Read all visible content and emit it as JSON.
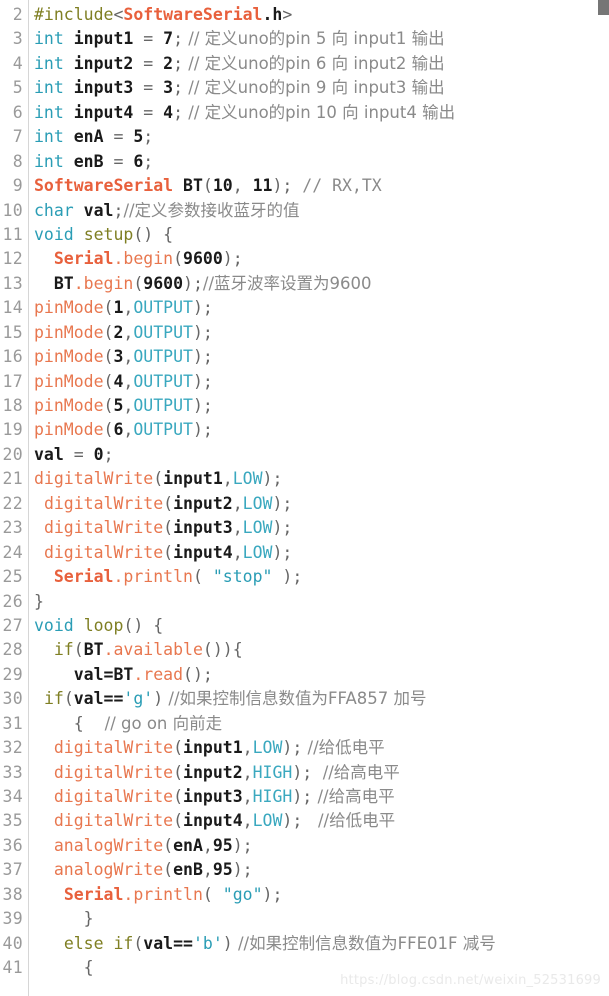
{
  "editor": {
    "language": "arduino-cpp",
    "first_line_number": 2,
    "last_line_number": 41,
    "colors": {
      "background": "#ffffff",
      "line_number": "#9a9a9a",
      "gutter_rule": "#d6d6d6",
      "type_keyword": "#2a9db5",
      "control_keyword": "#7f7f23",
      "function": "#e8774f",
      "class_name": "#e8603c",
      "constant": "#3aa8bf",
      "string": "#2a9db5",
      "comment": "#8a8a8a",
      "plain_text": "#1a1a1a",
      "scrollbar_thumb": "#767676",
      "watermark": "#e9e9e9"
    }
  },
  "watermark": {
    "text": "https://blog.csdn.net/weixin_52531699"
  },
  "lines": [
    {
      "n": "2",
      "tokens": [
        {
          "t": "keyword",
          "v": "#include"
        },
        {
          "t": "punct",
          "v": "<"
        },
        {
          "t": "class",
          "v": "SoftwareSerial"
        },
        {
          "t": "plain",
          "v": ".h"
        },
        {
          "t": "punct",
          "v": ">"
        }
      ]
    },
    {
      "n": "3",
      "tokens": [
        {
          "t": "type",
          "v": "int"
        },
        {
          "t": "plain",
          "v": " input1 "
        },
        {
          "t": "punct",
          "v": "="
        },
        {
          "t": "plain",
          "v": " 7"
        },
        {
          "t": "punct",
          "v": ";"
        },
        {
          "t": "comment",
          "v": " // 定义uno的pin 5 向 input1 输出"
        }
      ]
    },
    {
      "n": "4",
      "tokens": [
        {
          "t": "type",
          "v": "int"
        },
        {
          "t": "plain",
          "v": " input2 "
        },
        {
          "t": "punct",
          "v": "="
        },
        {
          "t": "plain",
          "v": " 2"
        },
        {
          "t": "punct",
          "v": ";"
        },
        {
          "t": "comment",
          "v": " // 定义uno的pin 6 向 input2 输出"
        }
      ]
    },
    {
      "n": "5",
      "tokens": [
        {
          "t": "type",
          "v": "int"
        },
        {
          "t": "plain",
          "v": " input3 "
        },
        {
          "t": "punct",
          "v": "="
        },
        {
          "t": "plain",
          "v": " 3"
        },
        {
          "t": "punct",
          "v": ";"
        },
        {
          "t": "comment",
          "v": " // 定义uno的pin 9 向 input3 输出"
        }
      ]
    },
    {
      "n": "6",
      "tokens": [
        {
          "t": "type",
          "v": "int"
        },
        {
          "t": "plain",
          "v": " input4 "
        },
        {
          "t": "punct",
          "v": "="
        },
        {
          "t": "plain",
          "v": " 4"
        },
        {
          "t": "punct",
          "v": ";"
        },
        {
          "t": "comment",
          "v": " // 定义uno的pin 10 向 input4 输出"
        }
      ]
    },
    {
      "n": "7",
      "tokens": [
        {
          "t": "type",
          "v": "int"
        },
        {
          "t": "plain",
          "v": " enA "
        },
        {
          "t": "punct",
          "v": "="
        },
        {
          "t": "plain",
          "v": " 5"
        },
        {
          "t": "punct",
          "v": ";"
        }
      ]
    },
    {
      "n": "8",
      "tokens": [
        {
          "t": "type",
          "v": "int"
        },
        {
          "t": "plain",
          "v": " enB "
        },
        {
          "t": "punct",
          "v": "="
        },
        {
          "t": "plain",
          "v": " 6"
        },
        {
          "t": "punct",
          "v": ";"
        }
      ]
    },
    {
      "n": "9",
      "tokens": [
        {
          "t": "class",
          "v": "SoftwareSerial"
        },
        {
          "t": "plain",
          "v": " BT"
        },
        {
          "t": "punct",
          "v": "("
        },
        {
          "t": "plain",
          "v": "10"
        },
        {
          "t": "punct",
          "v": ","
        },
        {
          "t": "plain",
          "v": " 11"
        },
        {
          "t": "punct",
          "v": ");"
        },
        {
          "t": "comment",
          "v": " // RX,TX"
        }
      ]
    },
    {
      "n": "10",
      "tokens": [
        {
          "t": "type",
          "v": "char"
        },
        {
          "t": "plain",
          "v": " val"
        },
        {
          "t": "punct",
          "v": ";"
        },
        {
          "t": "comment",
          "v": "//定义参数接收蓝牙的值"
        }
      ]
    },
    {
      "n": "11",
      "tokens": [
        {
          "t": "type",
          "v": "void"
        },
        {
          "t": "plain",
          "v": " "
        },
        {
          "t": "keyword",
          "v": "setup"
        },
        {
          "t": "punct",
          "v": "() {"
        }
      ]
    },
    {
      "n": "12",
      "tokens": [
        {
          "t": "plain",
          "v": "  "
        },
        {
          "t": "class",
          "v": "Serial"
        },
        {
          "t": "func",
          "v": ".begin"
        },
        {
          "t": "punct",
          "v": "("
        },
        {
          "t": "plain",
          "v": "9600"
        },
        {
          "t": "punct",
          "v": ");"
        }
      ]
    },
    {
      "n": "13",
      "tokens": [
        {
          "t": "plain",
          "v": "  BT"
        },
        {
          "t": "func",
          "v": ".begin"
        },
        {
          "t": "punct",
          "v": "("
        },
        {
          "t": "plain",
          "v": "9600"
        },
        {
          "t": "punct",
          "v": ");"
        },
        {
          "t": "comment",
          "v": "//蓝牙波率设置为9600"
        }
      ]
    },
    {
      "n": "14",
      "tokens": [
        {
          "t": "func",
          "v": "pinMode"
        },
        {
          "t": "punct",
          "v": "("
        },
        {
          "t": "plain",
          "v": "1"
        },
        {
          "t": "punct",
          "v": ","
        },
        {
          "t": "const",
          "v": "OUTPUT"
        },
        {
          "t": "punct",
          "v": ");"
        }
      ]
    },
    {
      "n": "15",
      "tokens": [
        {
          "t": "func",
          "v": "pinMode"
        },
        {
          "t": "punct",
          "v": "("
        },
        {
          "t": "plain",
          "v": "2"
        },
        {
          "t": "punct",
          "v": ","
        },
        {
          "t": "const",
          "v": "OUTPUT"
        },
        {
          "t": "punct",
          "v": ");"
        }
      ]
    },
    {
      "n": "16",
      "tokens": [
        {
          "t": "func",
          "v": "pinMode"
        },
        {
          "t": "punct",
          "v": "("
        },
        {
          "t": "plain",
          "v": "3"
        },
        {
          "t": "punct",
          "v": ","
        },
        {
          "t": "const",
          "v": "OUTPUT"
        },
        {
          "t": "punct",
          "v": ");"
        }
      ]
    },
    {
      "n": "17",
      "tokens": [
        {
          "t": "func",
          "v": "pinMode"
        },
        {
          "t": "punct",
          "v": "("
        },
        {
          "t": "plain",
          "v": "4"
        },
        {
          "t": "punct",
          "v": ","
        },
        {
          "t": "const",
          "v": "OUTPUT"
        },
        {
          "t": "punct",
          "v": ");"
        }
      ]
    },
    {
      "n": "18",
      "tokens": [
        {
          "t": "func",
          "v": "pinMode"
        },
        {
          "t": "punct",
          "v": "("
        },
        {
          "t": "plain",
          "v": "5"
        },
        {
          "t": "punct",
          "v": ","
        },
        {
          "t": "const",
          "v": "OUTPUT"
        },
        {
          "t": "punct",
          "v": ");"
        }
      ]
    },
    {
      "n": "19",
      "tokens": [
        {
          "t": "func",
          "v": "pinMode"
        },
        {
          "t": "punct",
          "v": "("
        },
        {
          "t": "plain",
          "v": "6"
        },
        {
          "t": "punct",
          "v": ","
        },
        {
          "t": "const",
          "v": "OUTPUT"
        },
        {
          "t": "punct",
          "v": ");"
        }
      ]
    },
    {
      "n": "20",
      "tokens": [
        {
          "t": "plain",
          "v": "val "
        },
        {
          "t": "punct",
          "v": "="
        },
        {
          "t": "plain",
          "v": " 0"
        },
        {
          "t": "punct",
          "v": ";"
        }
      ]
    },
    {
      "n": "21",
      "tokens": [
        {
          "t": "func",
          "v": "digitalWrite"
        },
        {
          "t": "punct",
          "v": "("
        },
        {
          "t": "plain",
          "v": "input1"
        },
        {
          "t": "punct",
          "v": ","
        },
        {
          "t": "const",
          "v": "LOW"
        },
        {
          "t": "punct",
          "v": ");"
        }
      ]
    },
    {
      "n": "22",
      "tokens": [
        {
          "t": "plain",
          "v": " "
        },
        {
          "t": "func",
          "v": "digitalWrite"
        },
        {
          "t": "punct",
          "v": "("
        },
        {
          "t": "plain",
          "v": "input2"
        },
        {
          "t": "punct",
          "v": ","
        },
        {
          "t": "const",
          "v": "LOW"
        },
        {
          "t": "punct",
          "v": ");"
        }
      ]
    },
    {
      "n": "23",
      "tokens": [
        {
          "t": "plain",
          "v": " "
        },
        {
          "t": "func",
          "v": "digitalWrite"
        },
        {
          "t": "punct",
          "v": "("
        },
        {
          "t": "plain",
          "v": "input3"
        },
        {
          "t": "punct",
          "v": ","
        },
        {
          "t": "const",
          "v": "LOW"
        },
        {
          "t": "punct",
          "v": ");"
        }
      ]
    },
    {
      "n": "24",
      "tokens": [
        {
          "t": "plain",
          "v": " "
        },
        {
          "t": "func",
          "v": "digitalWrite"
        },
        {
          "t": "punct",
          "v": "("
        },
        {
          "t": "plain",
          "v": "input4"
        },
        {
          "t": "punct",
          "v": ","
        },
        {
          "t": "const",
          "v": "LOW"
        },
        {
          "t": "punct",
          "v": ");"
        }
      ]
    },
    {
      "n": "25",
      "tokens": [
        {
          "t": "plain",
          "v": "  "
        },
        {
          "t": "class",
          "v": "Serial"
        },
        {
          "t": "func",
          "v": ".println"
        },
        {
          "t": "punct",
          "v": "( "
        },
        {
          "t": "string",
          "v": "\"stop\""
        },
        {
          "t": "punct",
          "v": " );"
        }
      ]
    },
    {
      "n": "26",
      "tokens": [
        {
          "t": "punct",
          "v": "}"
        }
      ]
    },
    {
      "n": "27",
      "tokens": [
        {
          "t": "type",
          "v": "void"
        },
        {
          "t": "plain",
          "v": " "
        },
        {
          "t": "keyword",
          "v": "loop"
        },
        {
          "t": "punct",
          "v": "() {"
        }
      ]
    },
    {
      "n": "28",
      "tokens": [
        {
          "t": "plain",
          "v": "  "
        },
        {
          "t": "keyword",
          "v": "if"
        },
        {
          "t": "punct",
          "v": "("
        },
        {
          "t": "plain",
          "v": "BT"
        },
        {
          "t": "func",
          "v": ".available"
        },
        {
          "t": "punct",
          "v": "()){"
        }
      ]
    },
    {
      "n": "29",
      "tokens": [
        {
          "t": "plain",
          "v": "    val=BT"
        },
        {
          "t": "func",
          "v": ".read"
        },
        {
          "t": "punct",
          "v": "();"
        }
      ]
    },
    {
      "n": "30",
      "tokens": [
        {
          "t": "plain",
          "v": " "
        },
        {
          "t": "keyword",
          "v": "if"
        },
        {
          "t": "punct",
          "v": "("
        },
        {
          "t": "plain",
          "v": "val=="
        },
        {
          "t": "string",
          "v": "'g'"
        },
        {
          "t": "punct",
          "v": ")"
        },
        {
          "t": "comment",
          "v": " //如果控制信息数值为FFA857 加号"
        }
      ]
    },
    {
      "n": "31",
      "tokens": [
        {
          "t": "punct",
          "v": "    {"
        },
        {
          "t": "comment",
          "v": "    // go on 向前走"
        }
      ]
    },
    {
      "n": "32",
      "tokens": [
        {
          "t": "plain",
          "v": "  "
        },
        {
          "t": "func",
          "v": "digitalWrite"
        },
        {
          "t": "punct",
          "v": "("
        },
        {
          "t": "plain",
          "v": "input1"
        },
        {
          "t": "punct",
          "v": ","
        },
        {
          "t": "const",
          "v": "LOW"
        },
        {
          "t": "punct",
          "v": ");"
        },
        {
          "t": "comment",
          "v": " //给低电平"
        }
      ]
    },
    {
      "n": "33",
      "tokens": [
        {
          "t": "plain",
          "v": "  "
        },
        {
          "t": "func",
          "v": "digitalWrite"
        },
        {
          "t": "punct",
          "v": "("
        },
        {
          "t": "plain",
          "v": "input2"
        },
        {
          "t": "punct",
          "v": ","
        },
        {
          "t": "const",
          "v": "HIGH"
        },
        {
          "t": "punct",
          "v": ");"
        },
        {
          "t": "comment",
          "v": "  //给高电平"
        }
      ]
    },
    {
      "n": "34",
      "tokens": [
        {
          "t": "plain",
          "v": "  "
        },
        {
          "t": "func",
          "v": "digitalWrite"
        },
        {
          "t": "punct",
          "v": "("
        },
        {
          "t": "plain",
          "v": "input3"
        },
        {
          "t": "punct",
          "v": ","
        },
        {
          "t": "const",
          "v": "HIGH"
        },
        {
          "t": "punct",
          "v": ");"
        },
        {
          "t": "comment",
          "v": " //给高电平"
        }
      ]
    },
    {
      "n": "35",
      "tokens": [
        {
          "t": "plain",
          "v": "  "
        },
        {
          "t": "func",
          "v": "digitalWrite"
        },
        {
          "t": "punct",
          "v": "("
        },
        {
          "t": "plain",
          "v": "input4"
        },
        {
          "t": "punct",
          "v": ","
        },
        {
          "t": "const",
          "v": "LOW"
        },
        {
          "t": "punct",
          "v": ");"
        },
        {
          "t": "comment",
          "v": "   //给低电平"
        }
      ]
    },
    {
      "n": "36",
      "tokens": [
        {
          "t": "plain",
          "v": "  "
        },
        {
          "t": "func",
          "v": "analogWrite"
        },
        {
          "t": "punct",
          "v": "("
        },
        {
          "t": "plain",
          "v": "enA"
        },
        {
          "t": "punct",
          "v": ","
        },
        {
          "t": "plain",
          "v": "95"
        },
        {
          "t": "punct",
          "v": ");"
        }
      ]
    },
    {
      "n": "37",
      "tokens": [
        {
          "t": "plain",
          "v": "  "
        },
        {
          "t": "func",
          "v": "analogWrite"
        },
        {
          "t": "punct",
          "v": "("
        },
        {
          "t": "plain",
          "v": "enB"
        },
        {
          "t": "punct",
          "v": ","
        },
        {
          "t": "plain",
          "v": "95"
        },
        {
          "t": "punct",
          "v": ");"
        }
      ]
    },
    {
      "n": "38",
      "tokens": [
        {
          "t": "plain",
          "v": "   "
        },
        {
          "t": "class",
          "v": "Serial"
        },
        {
          "t": "func",
          "v": ".println"
        },
        {
          "t": "punct",
          "v": "( "
        },
        {
          "t": "string",
          "v": "\"go\""
        },
        {
          "t": "punct",
          "v": ");"
        }
      ]
    },
    {
      "n": "39",
      "tokens": [
        {
          "t": "punct",
          "v": "     }"
        }
      ]
    },
    {
      "n": "40",
      "tokens": [
        {
          "t": "plain",
          "v": "   "
        },
        {
          "t": "keyword",
          "v": "else if"
        },
        {
          "t": "punct",
          "v": "("
        },
        {
          "t": "plain",
          "v": "val=="
        },
        {
          "t": "string",
          "v": "'b'"
        },
        {
          "t": "punct",
          "v": ")"
        },
        {
          "t": "comment",
          "v": " //如果控制信息数值为FFE01F 减号"
        }
      ]
    },
    {
      "n": "41",
      "tokens": [
        {
          "t": "punct",
          "v": "     {"
        }
      ]
    }
  ]
}
